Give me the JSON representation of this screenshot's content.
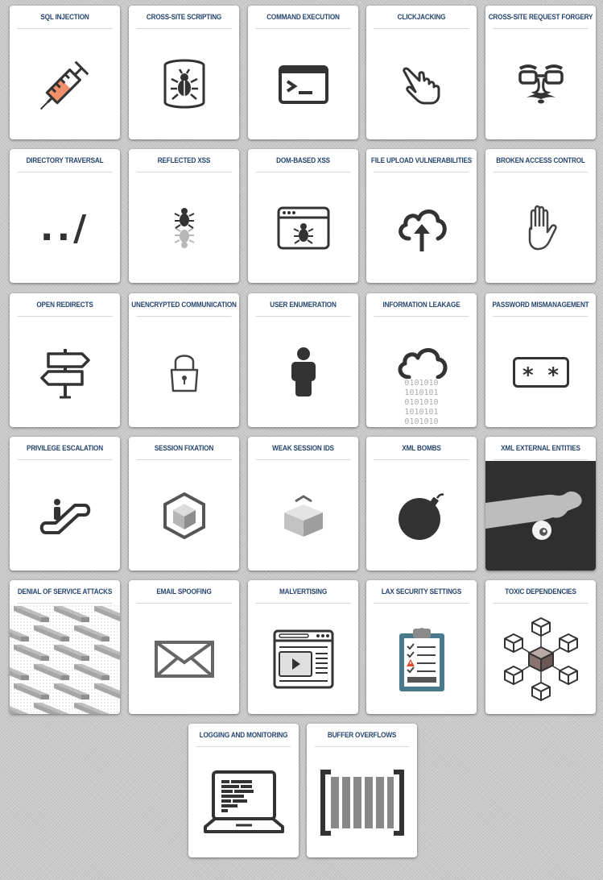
{
  "cards": [
    {
      "title": "SQL Injection",
      "icon": "syringe-icon"
    },
    {
      "title": "Cross-Site Scripting",
      "icon": "bug-database-icon"
    },
    {
      "title": "Command Execution",
      "icon": "terminal-icon"
    },
    {
      "title": "Clickjacking",
      "icon": "pointer-hand-icon"
    },
    {
      "title": "Cross-Site Request Forgery",
      "icon": "disguise-glasses-icon"
    },
    {
      "title": "Directory Traversal",
      "icon": "dot-dot-slash-icon",
      "glyph": "../"
    },
    {
      "title": "Reflected XSS",
      "icon": "reflected-bug-icon"
    },
    {
      "title": "DOM-Based XSS",
      "icon": "browser-bug-icon"
    },
    {
      "title": "File Upload Vulnerabilities",
      "icon": "cloud-upload-icon"
    },
    {
      "title": "Broken Access Control",
      "icon": "stop-hand-icon"
    },
    {
      "title": "Open Redirects",
      "icon": "signpost-icon"
    },
    {
      "title": "Unencrypted Communication",
      "icon": "padlock-icon"
    },
    {
      "title": "User Enumeration",
      "icon": "person-icon"
    },
    {
      "title": "Information Leakage",
      "icon": "leaking-cloud-icon",
      "binary": [
        "0101010",
        "1010101",
        "0101010",
        "1010101",
        "0101010"
      ]
    },
    {
      "title": "Password Mismanagement",
      "icon": "password-field-icon",
      "glyph": "* *"
    },
    {
      "title": "Privilege Escalation",
      "icon": "escalator-icon"
    },
    {
      "title": "Session Fixation",
      "icon": "hexagon-cube-icon"
    },
    {
      "title": "Weak Session IDs",
      "icon": "open-box-icon"
    },
    {
      "title": "XML Bombs",
      "icon": "bomb-icon"
    },
    {
      "title": "XML External Entities",
      "icon": "hand-grabbing-eye-icon"
    },
    {
      "title": "Denial of Service Attacks",
      "icon": "tile-pattern-icon"
    },
    {
      "title": "Email Spoofing",
      "icon": "envelope-icon"
    },
    {
      "title": "Malvertising",
      "icon": "browser-video-ad-icon"
    },
    {
      "title": "Lax Security Settings",
      "icon": "clipboard-checklist-icon"
    },
    {
      "title": "Toxic Dependencies",
      "icon": "dependency-cubes-icon"
    },
    {
      "title": "Logging and Monitoring",
      "icon": "laptop-log-icon"
    },
    {
      "title": "Buffer Overflows",
      "icon": "bracketed-bars-icon"
    }
  ],
  "colors": {
    "background": "#c9c9c9",
    "card": "#ffffff",
    "title_text": "#26456e",
    "icon_dark": "#333333",
    "syringe_fill": "#f0906a",
    "clipboard_frame": "#4a7a8c",
    "warning": "#e04a2a"
  }
}
